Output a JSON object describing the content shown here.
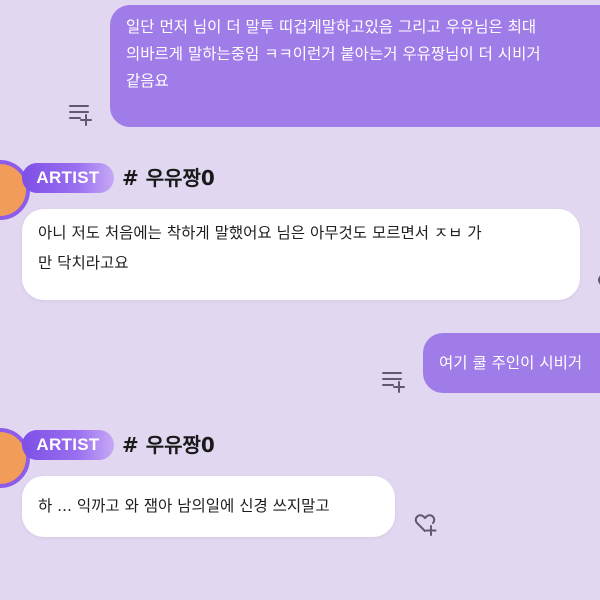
{
  "messages": {
    "out_1": {
      "lines": [
        "일단 먼저 님이 더 말투 띠겁게말하고있음 그리고 우유님은 최대",
        "의바르게 말하는중임 ㅋㅋ이런거 붙아는거 우유짱님이 더 시비거",
        "같음요"
      ],
      "icon": "add-to-playlist-icon"
    },
    "in_1": {
      "badge": "ARTIST",
      "username": "# 우유짱0",
      "lines": [
        "아니 저도 처음에는 착하게 말했어요 님은 아무것도 모르면서 ㅈㅂ 가",
        "만 닥치라고요"
      ]
    },
    "out_2": {
      "lines": [
        "여기 쿨 주인이 시비거"
      ],
      "icon": "add-to-playlist-icon"
    },
    "in_2": {
      "badge": "ARTIST",
      "username": "# 우유짱0",
      "lines": [
        "하 ... 익까고 와 잼아 남의일에 신경 쓰지말고"
      ],
      "icon": "heart-add-icon"
    }
  },
  "colors": {
    "background": "#e1d7f0",
    "outgoing_bubble": "#a07ce8",
    "incoming_bubble": "#ffffff",
    "badge_gradient_start": "#7d4fe6",
    "avatar_fill": "#f29c5a",
    "avatar_ring": "#8d5ce8",
    "icon_gray": "#5f5a6e"
  }
}
